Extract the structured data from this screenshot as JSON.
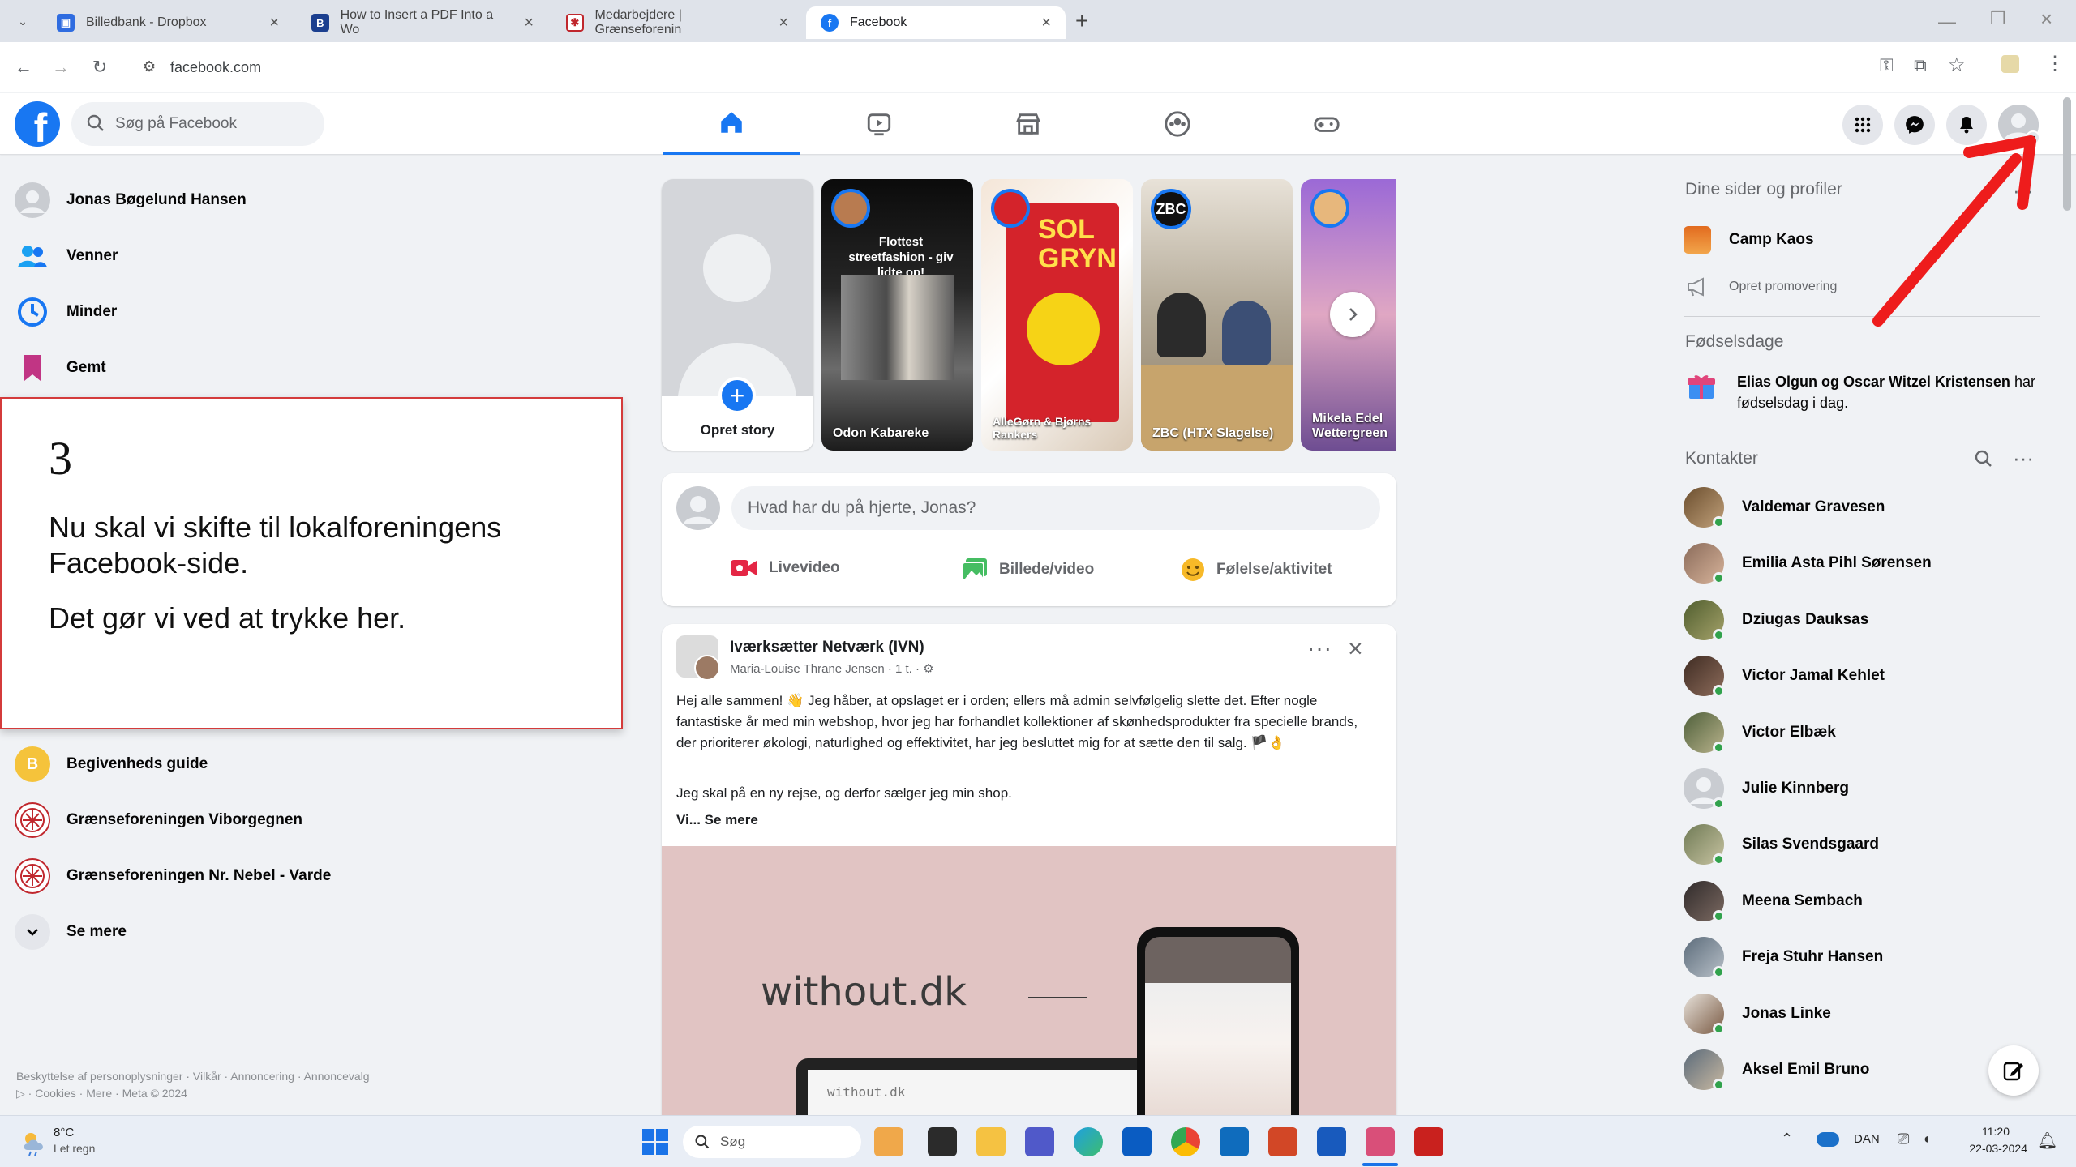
{
  "browser": {
    "tabs": [
      {
        "label": "Billedbank - Dropbox",
        "icon": "dropbox-icon",
        "color": "#2f6ce0"
      },
      {
        "label": "How to Insert a PDF Into a Wo",
        "icon": "wordpress-icon",
        "color": "#1b3f8f"
      },
      {
        "label": "Medarbejdere | Grænseforenin",
        "icon": "graenseforeningen-icon",
        "color": "#c0272d"
      },
      {
        "label": "Facebook",
        "icon": "facebook-icon",
        "color": "#1877f2"
      }
    ],
    "new_tab_label": "+",
    "url": "facebook.com"
  },
  "fb": {
    "search_placeholder": "Søg på Facebook",
    "accent": "#1877f2"
  },
  "left_nav": [
    {
      "label": "Jonas Bøgelund Hansen",
      "icon": "profile-avatar"
    },
    {
      "label": "Venner",
      "icon": "friends-icon"
    },
    {
      "label": "Minder",
      "icon": "memories-icon"
    },
    {
      "label": "Gemt",
      "icon": "saved-icon"
    }
  ],
  "left_shortcuts": [
    {
      "label": "Begivenheds guide",
      "badge": "B"
    },
    {
      "label": "Grænseforeningen Viborgegnen"
    },
    {
      "label": "Grænseforeningen Nr. Nebel - Varde"
    }
  ],
  "see_more": "Se mere",
  "footer": "Beskyttelse af personoplysninger · Vilkår · Annoncering · Annoncevalg ▷ · Cookies · Mere · Meta © 2024",
  "instruction": {
    "number": "3",
    "line1": "Nu skal vi skifte til lokalforeningens Facebook-side.",
    "line2": "Det gør vi ved at trykke her."
  },
  "stories": [
    {
      "label": "Opret story"
    },
    {
      "label": "Odon Kabareke",
      "headline": "Flottest streetfashion - giv lidte op!"
    },
    {
      "label": "AlleGørn & Bjørns Rankers",
      "headline": "SOL GRYN"
    },
    {
      "label": "ZBC (HTX Slagelse)",
      "headline": "ZBC"
    },
    {
      "label": "Mikela Edel Wettergreen"
    }
  ],
  "composer": {
    "placeholder": "Hvad har du på hjerte, Jonas?",
    "live": "Livevideo",
    "photo": "Billede/video",
    "feeling": "Følelse/aktivitet"
  },
  "post": {
    "group": "Iværksætter Netværk (IVN)",
    "author_meta": "Maria-Louise Thrane Jensen · 1 t. · ⚙",
    "text1": "Hej alle sammen! 👋 Jeg håber, at opslaget er i orden; ellers må admin selvfølgelig slette det. Efter nogle fantastiske år med min webshop, hvor jeg har forhandlet kollektioner af skønhedsprodukter fra specielle brands, der prioriterer økologi, naturlighed og effektivitet, har jeg besluttet mig for at sætte den til salg. 🏴👌",
    "text2": "Jeg skal på en ny rejse, og derfor sælger jeg min shop.",
    "see_more": "Vi... Se mere",
    "image_text": "without.dk",
    "laptop_text": "without.dk"
  },
  "right": {
    "pages_title": "Dine sider og profiler",
    "page_name": "Camp Kaos",
    "promote": "Opret promovering",
    "birthdays_title": "Fødselsdage",
    "birthday_names": "Elias Olgun og Oscar Witzel Kristensen",
    "birthday_suffix": "har fødselsdag i dag.",
    "contacts_title": "Kontakter",
    "contacts": [
      "Valdemar Gravesen",
      "Emilia Asta Pihl Sørensen",
      "Dziugas Dauksas",
      "Victor Jamal Kehlet",
      "Victor Elbæk",
      "Julie Kinnberg",
      "Silas Svendsgaard",
      "Meena Sembach",
      "Freja Stuhr Hansen",
      "Jonas Linke",
      "Aksel Emil Bruno"
    ]
  },
  "taskbar": {
    "weather_temp": "8°C",
    "weather_desc": "Let regn",
    "search": "Søg",
    "lang": "DAN",
    "time": "11:20",
    "date": "22-03-2024"
  }
}
